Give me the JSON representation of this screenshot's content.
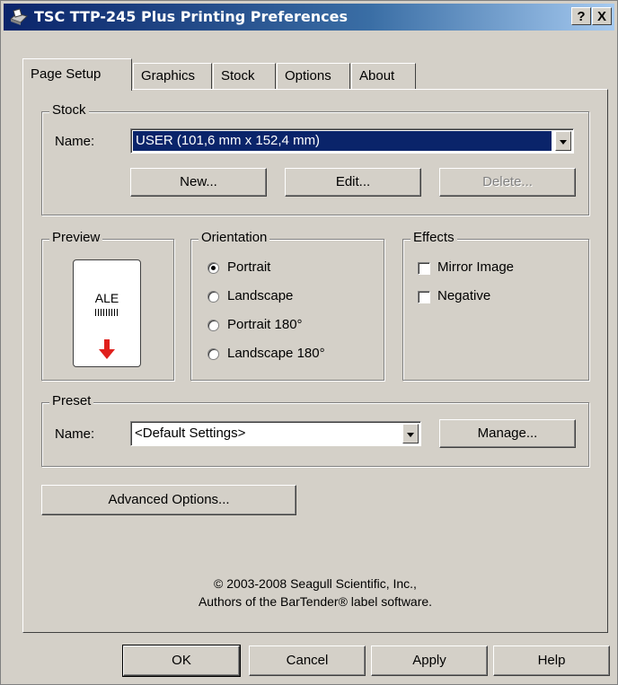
{
  "window": {
    "title": "TSC TTP-245 Plus Printing Preferences",
    "help_btn": "?",
    "close_btn": "X"
  },
  "tabs": [
    {
      "label": "Page Setup",
      "active": true
    },
    {
      "label": "Graphics"
    },
    {
      "label": "Stock"
    },
    {
      "label": "Options"
    },
    {
      "label": "About"
    }
  ],
  "stock": {
    "group_label": "Stock",
    "name_label": "Name:",
    "name_value": "USER (101,6 mm x 152,4 mm)",
    "new_btn": "New...",
    "edit_btn": "Edit...",
    "delete_btn": "Delete..."
  },
  "preview": {
    "group_label": "Preview",
    "sample_text": "ALE"
  },
  "orientation": {
    "group_label": "Orientation",
    "options": [
      {
        "label": "Portrait",
        "selected": true
      },
      {
        "label": "Landscape",
        "selected": false
      },
      {
        "label": "Portrait 180°",
        "selected": false
      },
      {
        "label": "Landscape 180°",
        "selected": false
      }
    ]
  },
  "effects": {
    "group_label": "Effects",
    "options": [
      {
        "label": "Mirror Image",
        "checked": false
      },
      {
        "label": "Negative",
        "checked": false
      }
    ]
  },
  "preset": {
    "group_label": "Preset",
    "name_label": "Name:",
    "name_value": "<Default Settings>",
    "manage_btn": "Manage..."
  },
  "advanced_btn": "Advanced Options...",
  "copyright": {
    "line1": "© 2003-2008 Seagull Scientific, Inc.,",
    "line2": "Authors of the BarTender® label software."
  },
  "footer": {
    "ok": "OK",
    "cancel": "Cancel",
    "apply": "Apply",
    "help": "Help"
  },
  "colors": {
    "title_start": "#0a246a",
    "title_end": "#a6caf0",
    "face": "#d4d0c8",
    "selection": "#0a246a",
    "preview_arrow": "#e0201c"
  }
}
